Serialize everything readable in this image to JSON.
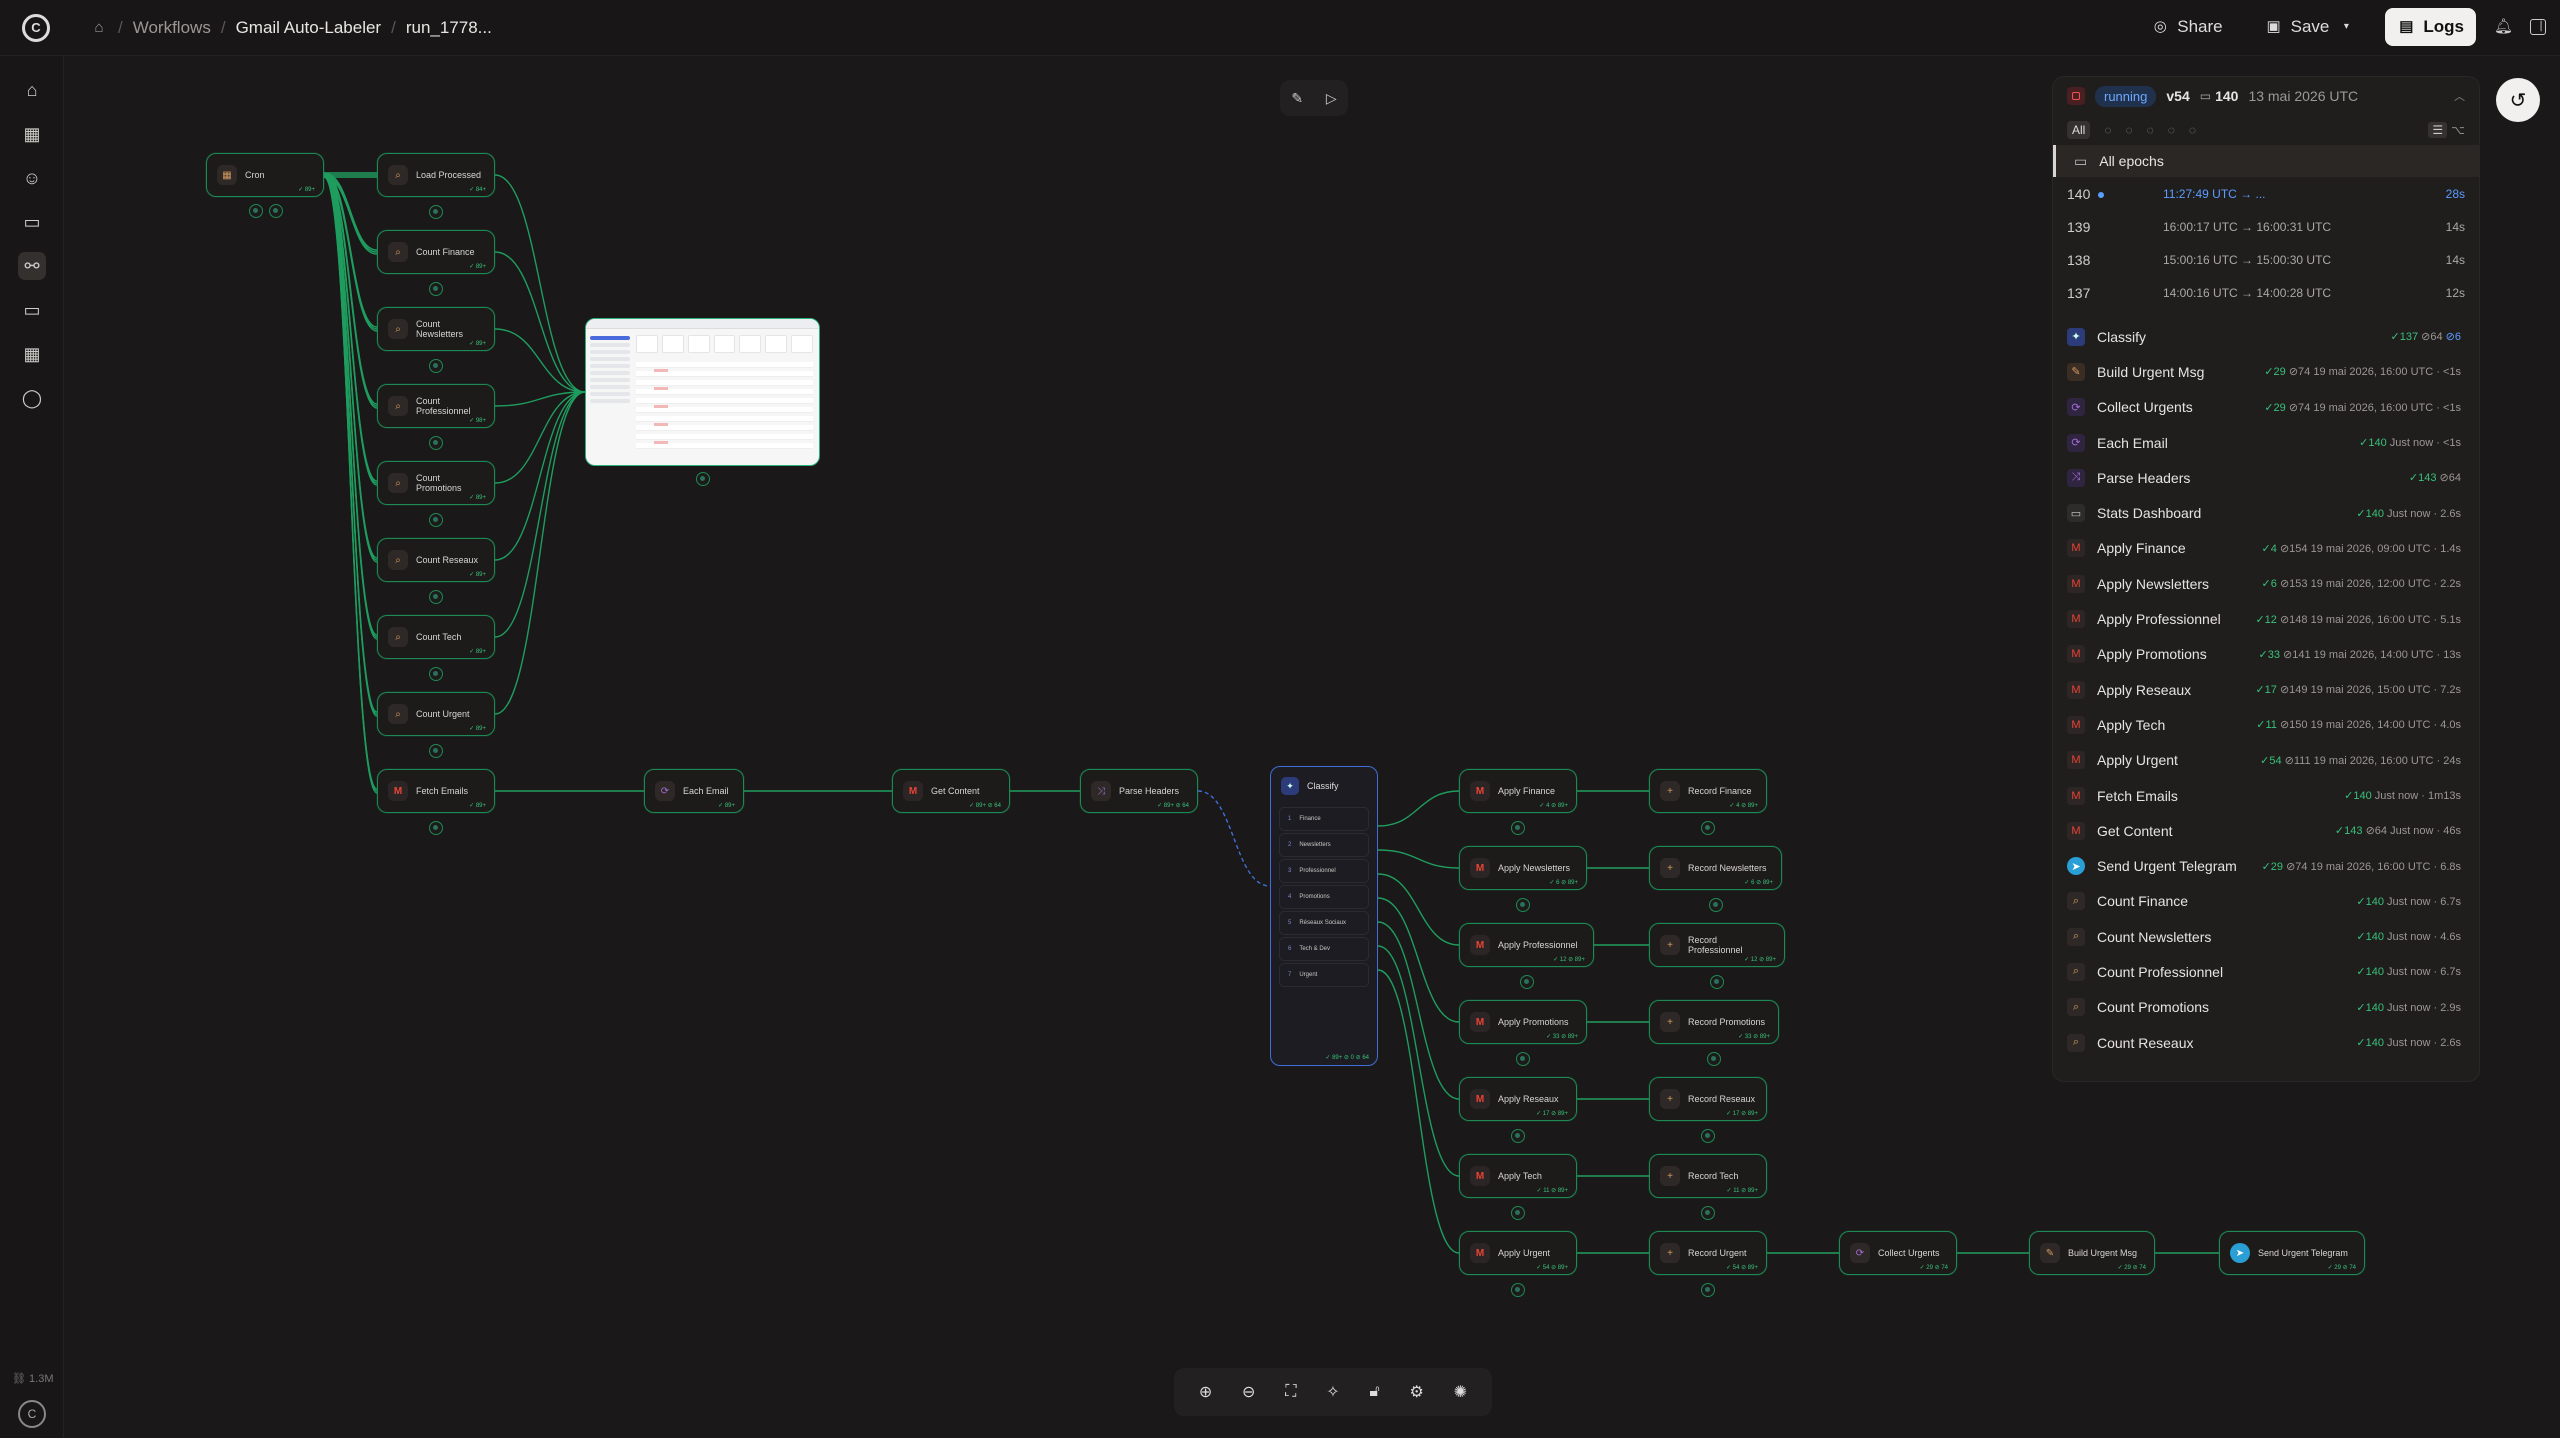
{
  "breadcrumb": {
    "workflows": "Workflows",
    "project": "Gmail Auto-Labeler",
    "run": "run_1778..."
  },
  "top": {
    "share": "Share",
    "save": "Save",
    "logs": "Logs"
  },
  "canvas": {
    "nodes": [
      {
        "id": "cron",
        "label": "Cron",
        "icon": "cron",
        "stat": "✓ 89+"
      },
      {
        "id": "load",
        "label": "Load Processed",
        "icon": "search",
        "stat": "✓ 84+"
      },
      {
        "id": "cf",
        "label": "Count Finance",
        "icon": "search",
        "stat": "✓ 89+"
      },
      {
        "id": "cn",
        "label": "Count Newsletters",
        "icon": "search",
        "stat": "✓ 89+"
      },
      {
        "id": "cp",
        "label": "Count Professionnel",
        "icon": "search",
        "stat": "✓ 98+"
      },
      {
        "id": "cpr",
        "label": "Count Promotions",
        "icon": "search",
        "stat": "✓ 89+"
      },
      {
        "id": "cr",
        "label": "Count Reseaux",
        "icon": "search",
        "stat": "✓ 89+"
      },
      {
        "id": "ct",
        "label": "Count Tech",
        "icon": "search",
        "stat": "✓ 89+"
      },
      {
        "id": "cu",
        "label": "Count Urgent",
        "icon": "search",
        "stat": "✓ 89+"
      },
      {
        "id": "fe",
        "label": "Fetch Emails",
        "icon": "gmail",
        "stat": "✓ 89+"
      },
      {
        "id": "ee",
        "label": "Each Email",
        "icon": "loop",
        "stat": "✓ 89+"
      },
      {
        "id": "gc",
        "label": "Get Content",
        "icon": "gmail",
        "stat": "✓ 89+ ⊘ 64"
      },
      {
        "id": "ph",
        "label": "Parse Headers",
        "icon": "shuffle",
        "stat": "✓ 89+ ⊘ 64"
      },
      {
        "id": "af",
        "label": "Apply Finance",
        "icon": "gmail",
        "stat": "✓ 4 ⊘ 89+"
      },
      {
        "id": "rf",
        "label": "Record Finance",
        "icon": "plus",
        "stat": "✓ 4 ⊘ 89+"
      },
      {
        "id": "an",
        "label": "Apply Newsletters",
        "icon": "gmail",
        "stat": "✓ 6 ⊘ 89+"
      },
      {
        "id": "rn",
        "label": "Record Newsletters",
        "icon": "plus",
        "stat": "✓ 6 ⊘ 89+"
      },
      {
        "id": "ap",
        "label": "Apply Professionnel",
        "icon": "gmail",
        "stat": "✓ 12 ⊘ 89+"
      },
      {
        "id": "rp",
        "label": "Record Professionnel",
        "icon": "plus",
        "stat": "✓ 12 ⊘ 89+"
      },
      {
        "id": "apr",
        "label": "Apply Promotions",
        "icon": "gmail",
        "stat": "✓ 33 ⊘ 89+"
      },
      {
        "id": "rpr",
        "label": "Record Promotions",
        "icon": "plus",
        "stat": "✓ 33 ⊘ 89+"
      },
      {
        "id": "ar",
        "label": "Apply Reseaux",
        "icon": "gmail",
        "stat": "✓ 17 ⊘ 89+"
      },
      {
        "id": "rr",
        "label": "Record Reseaux",
        "icon": "plus",
        "stat": "✓ 17 ⊘ 89+"
      },
      {
        "id": "at",
        "label": "Apply Tech",
        "icon": "gmail",
        "stat": "✓ 11 ⊘ 89+"
      },
      {
        "id": "rt",
        "label": "Record Tech",
        "icon": "plus",
        "stat": "✓ 11 ⊘ 89+"
      },
      {
        "id": "au",
        "label": "Apply Urgent",
        "icon": "gmail",
        "stat": "✓ 54 ⊘ 89+"
      },
      {
        "id": "ru",
        "label": "Record Urgent",
        "icon": "plus",
        "stat": "✓ 54 ⊘ 89+"
      },
      {
        "id": "cug",
        "label": "Collect Urgents",
        "icon": "loop",
        "stat": "✓ 29 ⊘ 74"
      },
      {
        "id": "bum",
        "label": "Build Urgent Msg",
        "icon": "pen",
        "stat": "✓ 29 ⊘ 74"
      },
      {
        "id": "sut",
        "label": "Send Urgent Telegram",
        "icon": "telegram",
        "stat": "✓ 29 ⊘ 74"
      }
    ],
    "classify": {
      "label": "Classify",
      "rows": [
        {
          "n": "1",
          "label": "Finance"
        },
        {
          "n": "2",
          "label": "Newsletters"
        },
        {
          "n": "3",
          "label": "Professionnel"
        },
        {
          "n": "4",
          "label": "Promotions"
        },
        {
          "n": "5",
          "label": "Réseaux Sociaux"
        },
        {
          "n": "6",
          "label": "Tech & Dev"
        },
        {
          "n": "7",
          "label": "Urgent"
        }
      ],
      "stat": "✓ 89+ ⊘ 0 ⊘ 64"
    },
    "edge_labels": [
      "89+",
      "89+",
      "89+ ⊘ 64",
      "89+ ⊘ 64",
      "89+ ⊘ 64",
      "89+ ⊘ 0 ⊘ 64"
    ]
  },
  "panel": {
    "status": "running",
    "version": "v54",
    "epoch": "140",
    "date": "13 mai 2026 UTC",
    "filter_all": "All",
    "all_epochs": "All epochs",
    "epochs": [
      {
        "n": "140",
        "time": "11:27:49 UTC → ...",
        "dur": "28s",
        "current": true
      },
      {
        "n": "139",
        "time": "16:00:17 UTC → 16:00:31 UTC",
        "dur": "14s"
      },
      {
        "n": "138",
        "time": "15:00:16 UTC → 15:00:30 UTC",
        "dur": "14s"
      },
      {
        "n": "137",
        "time": "14:00:16 UTC → 14:00:28 UTC",
        "dur": "12s"
      }
    ],
    "nodes": [
      {
        "icon": "classify",
        "name": "Classify",
        "ok": "✓137",
        "meta": "⊘64",
        "extra": "⊘6"
      },
      {
        "icon": "pen",
        "name": "Build Urgent Msg",
        "ok": "✓29",
        "meta": "⊘74  19 mai 2026, 16:00 UTC · <1s"
      },
      {
        "icon": "loop",
        "name": "Collect Urgents",
        "ok": "✓29",
        "meta": "⊘74  19 mai 2026, 16:00 UTC · <1s"
      },
      {
        "icon": "loop",
        "name": "Each Email",
        "ok": "✓140",
        "meta": "Just now · <1s"
      },
      {
        "icon": "shuffle",
        "name": "Parse Headers",
        "ok": "✓143",
        "meta": "⊘64"
      },
      {
        "icon": "monitor",
        "name": "Stats Dashboard",
        "ok": "✓140",
        "meta": "Just now · 2.6s"
      },
      {
        "icon": "gmail",
        "name": "Apply Finance",
        "ok": "✓4",
        "meta": "⊘154  19 mai 2026, 09:00 UTC · 1.4s"
      },
      {
        "icon": "gmail",
        "name": "Apply Newsletters",
        "ok": "✓6",
        "meta": "⊘153  19 mai 2026, 12:00 UTC · 2.2s"
      },
      {
        "icon": "gmail",
        "name": "Apply Professionnel",
        "ok": "✓12",
        "meta": "⊘148  19 mai 2026, 16:00 UTC · 5.1s"
      },
      {
        "icon": "gmail",
        "name": "Apply Promotions",
        "ok": "✓33",
        "meta": "⊘141  19 mai 2026, 14:00 UTC · 13s"
      },
      {
        "icon": "gmail",
        "name": "Apply Reseaux",
        "ok": "✓17",
        "meta": "⊘149  19 mai 2026, 15:00 UTC · 7.2s"
      },
      {
        "icon": "gmail",
        "name": "Apply Tech",
        "ok": "✓11",
        "meta": "⊘150  19 mai 2026, 14:00 UTC · 4.0s"
      },
      {
        "icon": "gmail",
        "name": "Apply Urgent",
        "ok": "✓54",
        "meta": "⊘111  19 mai 2026, 16:00 UTC · 24s"
      },
      {
        "icon": "gmail",
        "name": "Fetch Emails",
        "ok": "✓140",
        "meta": "Just now · 1m13s"
      },
      {
        "icon": "gmail",
        "name": "Get Content",
        "ok": "✓143",
        "meta": "⊘64  Just now · 46s"
      },
      {
        "icon": "telegram",
        "name": "Send Urgent Telegram",
        "ok": "✓29",
        "meta": "⊘74  19 mai 2026, 16:00 UTC · 6.8s"
      },
      {
        "icon": "search",
        "name": "Count Finance",
        "ok": "✓140",
        "meta": "Just now · 6.7s"
      },
      {
        "icon": "search",
        "name": "Count Newsletters",
        "ok": "✓140",
        "meta": "Just now · 4.6s"
      },
      {
        "icon": "search",
        "name": "Count Professionnel",
        "ok": "✓140",
        "meta": "Just now · 6.7s"
      },
      {
        "icon": "search",
        "name": "Count Promotions",
        "ok": "✓140",
        "meta": "Just now · 2.9s"
      },
      {
        "icon": "search",
        "name": "Count Reseaux",
        "ok": "✓140",
        "meta": "Just now · 2.6s"
      }
    ]
  },
  "footer": {
    "memory": "1.3M"
  }
}
